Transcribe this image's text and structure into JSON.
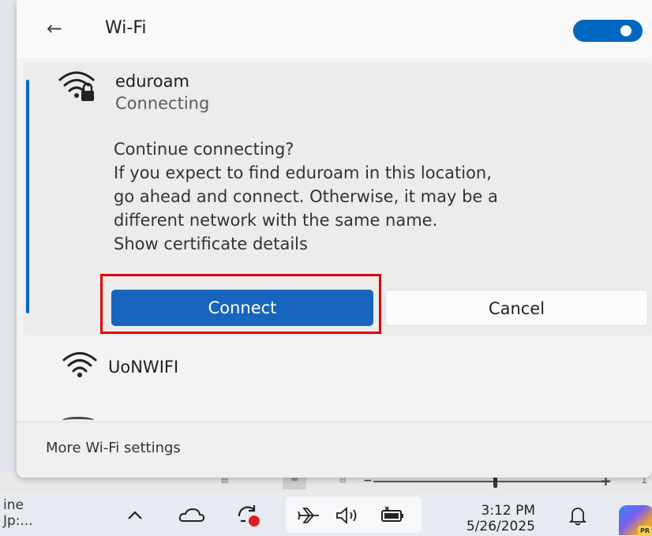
{
  "wifi_panel": {
    "back_icon": "arrow-left-icon",
    "title": "Wi-Fi",
    "toggle_state": "on",
    "accent_color": "#0067c0",
    "networks": [
      {
        "name": "eduroam",
        "status": "Connecting",
        "secured": true,
        "prompt_lines": [
          "Continue connecting?",
          "If you expect to find eduroam in this location,",
          "go ahead and connect. Otherwise, it may be a",
          "different network with the same name.",
          "Show certificate details"
        ],
        "connect_label": "Connect",
        "cancel_label": "Cancel"
      },
      {
        "name": "UoNWIFI",
        "secured": false
      }
    ],
    "more_settings_label": "More Wi-Fi settings"
  },
  "highlight_color": "#e00000",
  "taskbar": {
    "partial_text_line1": "ine",
    "partial_text_line2": "Jp:...",
    "time": "3:12 PM",
    "date": "5/26/2025",
    "copilot_badge": "PR",
    "tray_icons": [
      "chevron-up-icon",
      "onedrive-cloud-icon",
      "sync-alert-icon",
      "airplane-icon",
      "volume-icon",
      "battery-icon",
      "bell-icon",
      "copilot-icon"
    ]
  }
}
